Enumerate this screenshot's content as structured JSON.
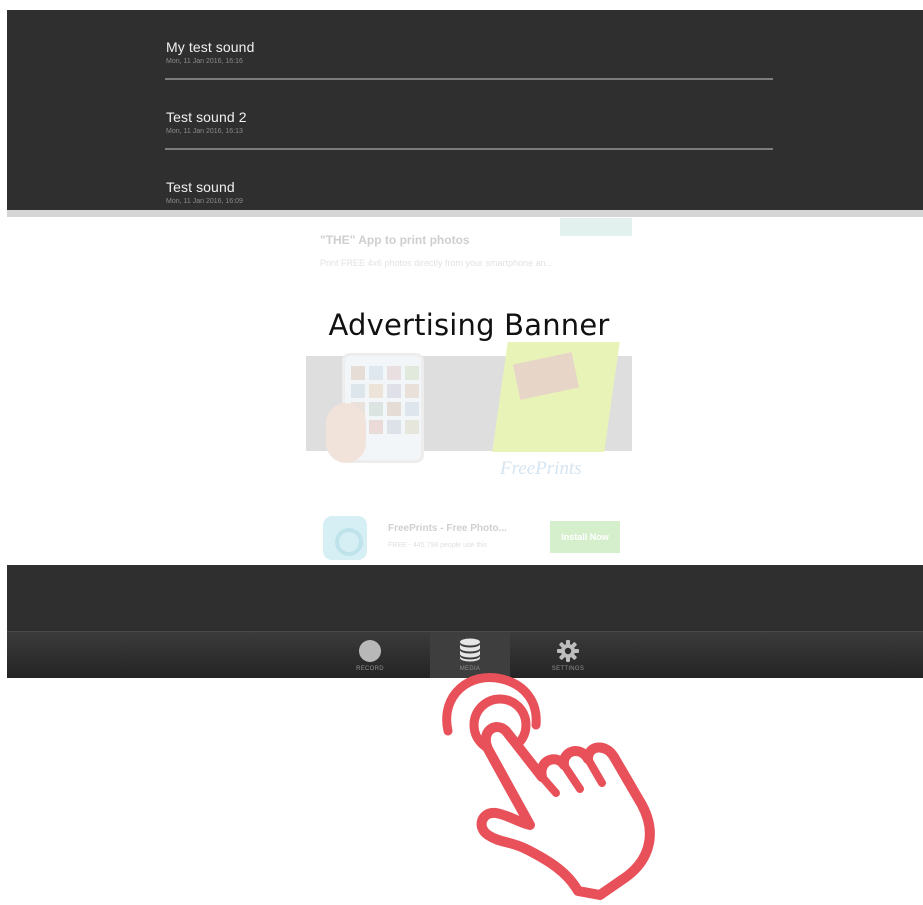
{
  "recordings": [
    {
      "title": "My test sound",
      "date": "Mon, 11 Jan 2016, 16:16"
    },
    {
      "title": "Test sound 2",
      "date": "Mon, 11 Jan 2016, 16:13"
    },
    {
      "title": "Test sound",
      "date": "Mon, 11 Jan 2016, 16:09"
    }
  ],
  "ad": {
    "label": "Advertising Banner",
    "headline": "\"THE\" App to print photos",
    "description": "Print FREE 4x6 photos directly from your smartphone an...",
    "brand": "FreePrints",
    "app_name": "FreePrints - Free Photo...",
    "app_meta": "FREE - 445,798 people use this",
    "install_label": "Install Now"
  },
  "tabs": [
    {
      "label": "RECORD",
      "icon": "record-icon",
      "active": false
    },
    {
      "label": "MEDIA",
      "icon": "database-icon",
      "active": true
    },
    {
      "label": "SETTINGS",
      "icon": "gear-icon",
      "active": false
    }
  ],
  "colors": {
    "panel": "#2f2f2f",
    "title_text": "#f0f0f0",
    "hand_outline": "#e8515a"
  }
}
